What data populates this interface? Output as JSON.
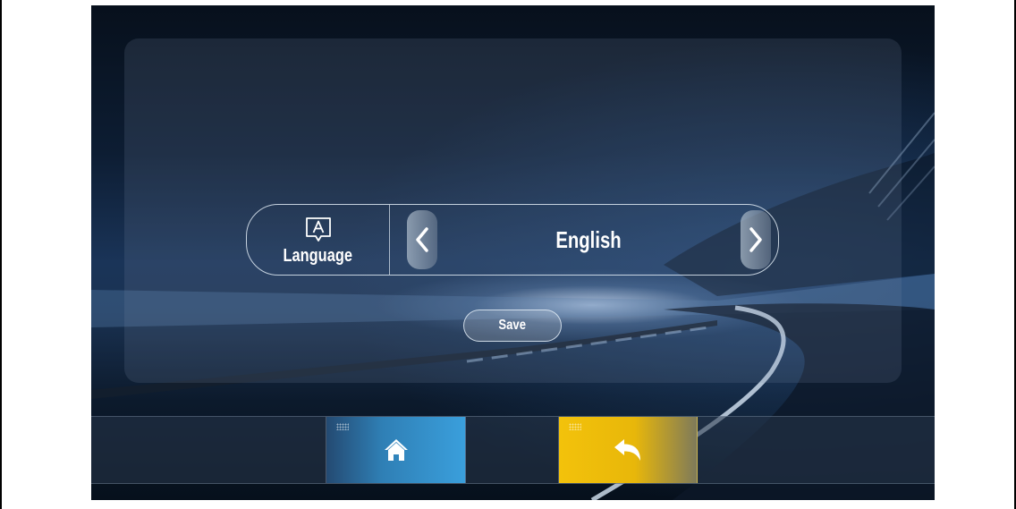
{
  "settings": {
    "language_label": "Language",
    "language_value": "English",
    "save_label": "Save"
  },
  "icons": {
    "language": "language-icon",
    "prev": "chevron-left-icon",
    "next": "chevron-right-icon",
    "home": "home-icon",
    "back": "back-icon"
  },
  "colors": {
    "home_accent": "#3a9fdc",
    "back_accent": "#f3c20b"
  }
}
